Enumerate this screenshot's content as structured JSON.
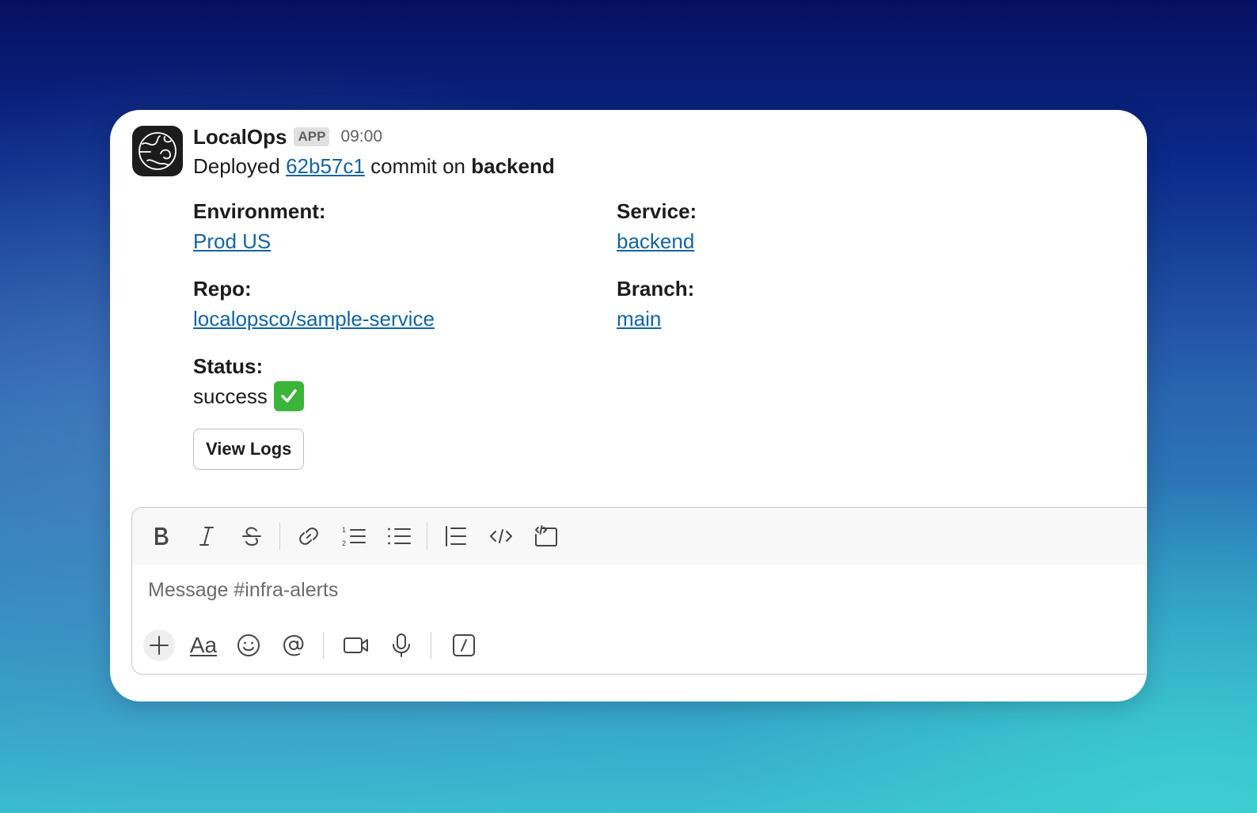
{
  "message": {
    "app_name": "LocalOps",
    "app_badge": "APP",
    "timestamp": "09:00",
    "intro": {
      "prefix": "Deployed",
      "commit": "62b57c1",
      "middle": "commit on",
      "service": "backend"
    },
    "fields": [
      {
        "label": "Environment:",
        "value": "Prod US"
      },
      {
        "label": "Service:",
        "value": "backend"
      },
      {
        "label": "Repo:",
        "value": "localopsco/sample-service"
      },
      {
        "label": "Branch:",
        "value": "main"
      },
      {
        "label": "Status:",
        "value": "success"
      }
    ],
    "status_icon": "check-mark-emoji",
    "status_icon_color": "#3ab53a",
    "button_label": "View Logs"
  },
  "composer": {
    "placeholder": "Message #infra-alerts",
    "format_tools": [
      "bold-icon",
      "italic-icon",
      "strikethrough-icon",
      "link-icon",
      "ordered-list-icon",
      "bulleted-list-icon",
      "blockquote-icon",
      "code-icon",
      "code-block-icon"
    ],
    "bottom_tools": [
      "plus-icon",
      "formatting-icon",
      "emoji-icon",
      "mention-icon",
      "video-icon",
      "microphone-icon",
      "shortcuts-icon"
    ],
    "formatting_label": "Aa"
  },
  "colors": {
    "link": "#1264a3",
    "text": "#1d1c1d",
    "muted": "#616061"
  }
}
